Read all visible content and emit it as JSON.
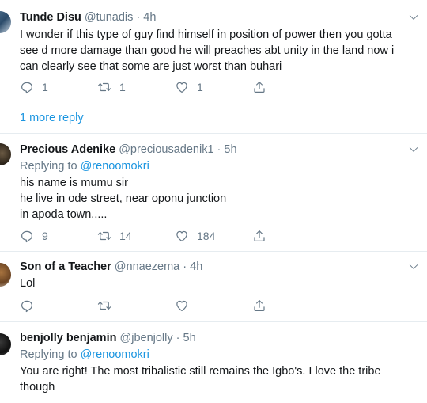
{
  "tweets": [
    {
      "name": "Tunde Disu",
      "handle": "@tunadis",
      "time": "4h",
      "replying": null,
      "lines": [
        "I wonder if this type of guy find himself in position of power then you gotta",
        "see d more damage than good he will preaches abt unity in the land now i",
        "can clearly see that some are just worst than buhari"
      ],
      "replies": "1",
      "retweets": "1",
      "likes": "1"
    },
    {
      "name": "Precious Adenike",
      "handle": "@preciousadenik1",
      "time": "5h",
      "replying_prefix": "Replying to",
      "replying_to": "@renoomokri",
      "lines": [
        "his name is mumu sir",
        "he live in ode street, near oponu junction",
        "in apoda town....."
      ],
      "replies": "9",
      "retweets": "14",
      "likes": "184"
    },
    {
      "name": "Son of a Teacher",
      "handle": "@nnaezema",
      "time": "4h",
      "lines": [
        "Lol"
      ],
      "replies": "",
      "retweets": "",
      "likes": ""
    },
    {
      "name": "benjolly benjamin",
      "handle": "@jbenjolly",
      "time": "5h",
      "replying_prefix": "Replying to",
      "replying_to": "@renoomokri",
      "lines": [
        "You are right! The most tribalistic still remains the Igbo's. I love the tribe",
        "though"
      ]
    }
  ],
  "more_replies": "1 more reply",
  "separator": "·",
  "icons": {
    "reply": "reply-icon",
    "retweet": "retweet-icon",
    "like": "like-icon",
    "share": "share-icon",
    "caret": "chevron-down-icon"
  },
  "colors": {
    "link": "#1b95e0",
    "muted": "#657786",
    "divider": "#e6ecf0"
  }
}
